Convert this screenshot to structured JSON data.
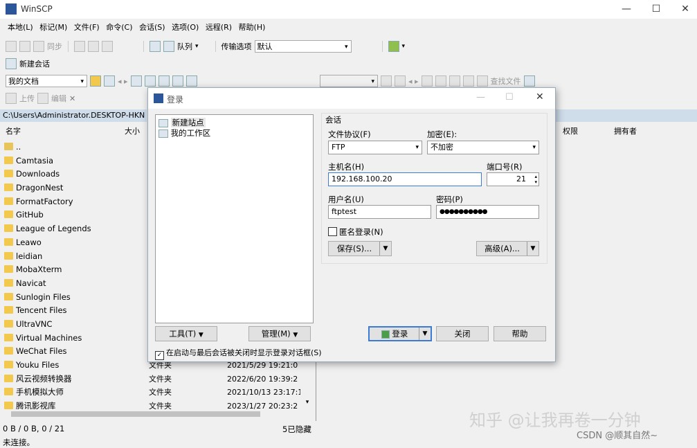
{
  "window": {
    "title": "WinSCP"
  },
  "menu": [
    "本地(L)",
    "标记(M)",
    "文件(F)",
    "命令(C)",
    "会话(S)",
    "选项(O)",
    "远程(R)",
    "帮助(H)"
  ],
  "toolbar1": {
    "sync": "同步",
    "queue": "队列",
    "transfer_label": "传输选项",
    "transfer_value": "默认"
  },
  "toolbar2": {
    "new_session": "新建会话"
  },
  "local": {
    "location": "我的文档",
    "upload": "上传",
    "edit": "编辑",
    "path": "C:\\Users\\Administrator.DESKTOP-HKN",
    "col_name": "名字",
    "col_size": "大小",
    "parent": "..",
    "folders": [
      "Camtasia",
      "Downloads",
      "DragonNest",
      "FormatFactory",
      "GitHub",
      "League of Legends",
      "Leawo",
      "leidian",
      "MobaXterm",
      "Navicat",
      "Sunlogin Files",
      "Tencent Files",
      "UltraVNC",
      "Virtual Machines",
      "WeChat Files",
      "Youku Files",
      "风云视频转换器",
      "手机模拟大师",
      "腾讯影视库"
    ],
    "visible_rows": [
      {
        "type": "文件夹",
        "date": "2021/5/29  19:21:0"
      },
      {
        "type": "文件夹",
        "date": "2022/6/20  19:39:2"
      },
      {
        "type": "文件夹",
        "date": "2021/10/13  23:17:1"
      },
      {
        "type": "文件夹",
        "date": "2023/1/27  20:23:2"
      }
    ],
    "status_size": "0 B / 0 B,  0 / 21",
    "hidden": "5已隐藏"
  },
  "remote": {
    "find_files": "查找文件",
    "col_perm": "权限",
    "col_owner": "拥有者"
  },
  "status": {
    "connection": "未连接。"
  },
  "dialog": {
    "title": "登录",
    "sites": [
      {
        "label": "新建站点"
      },
      {
        "label": "我的工作区"
      }
    ],
    "group_title": "会话",
    "protocol_label": "文件协议(F)",
    "protocol_value": "FTP",
    "encryption_label": "加密(E):",
    "encryption_value": "不加密",
    "host_label": "主机名(H)",
    "host_value": "192.168.100.20",
    "port_label": "端口号(R)",
    "port_value": "21",
    "user_label": "用户名(U)",
    "user_value": "ftptest",
    "password_label": "密码(P)",
    "password_value": "●●●●●●●●●●",
    "anonymous_label": "匿名登录(N)",
    "save_label": "保存(S)...",
    "advanced_label": "高级(A)...",
    "tools_label": "工具(T)",
    "manage_label": "管理(M)",
    "startup_checkbox": "在启动与最后会话被关闭时显示登录对话框(S)",
    "login_label": "登录",
    "close_label": "关闭",
    "help_label": "帮助"
  },
  "watermark": {
    "zhihu": "知乎 @让我再卷一分钟",
    "csdn": "CSDN @顺其自然~"
  }
}
